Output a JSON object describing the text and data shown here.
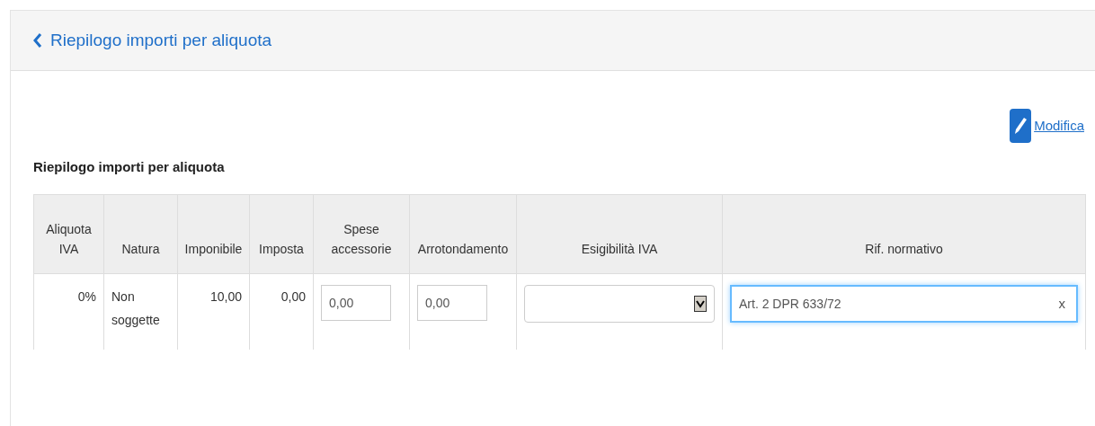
{
  "header": {
    "title": "Riepilogo importi per aliquota"
  },
  "edit_link": {
    "label": "Modifica"
  },
  "section_title": "Riepilogo importi per aliquota",
  "table": {
    "columns": [
      {
        "label": "Aliquota IVA"
      },
      {
        "label": "Natura"
      },
      {
        "label": "Imponibile"
      },
      {
        "label": "Imposta"
      },
      {
        "label": "Spese accessorie"
      },
      {
        "label": "Arrotondamento"
      },
      {
        "label": "Esigibilità IVA"
      },
      {
        "label": "Rif. normativo"
      }
    ],
    "rows": [
      {
        "cells": [
          {
            "kind": "number",
            "text": "0%"
          },
          {
            "kind": "text",
            "text": "Non soggette"
          },
          {
            "kind": "number",
            "text": "10,00"
          },
          {
            "kind": "number",
            "text": "0,00"
          },
          {
            "kind": "input",
            "value": "0,00"
          },
          {
            "kind": "input",
            "value": "0,00"
          },
          {
            "kind": "select"
          },
          {
            "kind": "clearable_input",
            "value": "Art. 2 DPR 633/72",
            "focused": true,
            "clear_label": "x"
          }
        ]
      }
    ]
  }
}
